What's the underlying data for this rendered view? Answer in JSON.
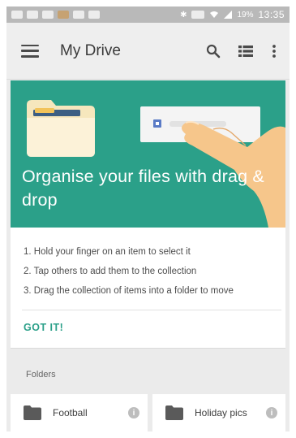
{
  "status_bar": {
    "time": "13:35",
    "battery": "19%"
  },
  "app_bar": {
    "title": "My Drive",
    "icons": [
      "menu-icon",
      "search-icon",
      "list-view-icon",
      "more-vert-icon"
    ]
  },
  "promo": {
    "text": "Organise your files with drag & drop",
    "background": "#2ba089"
  },
  "instructions": {
    "steps": [
      "1. Hold your finger on an item to select it",
      "2. Tap others to add them to the collection",
      "3. Drag the collection of items into a folder to move"
    ],
    "action_label": "GOT IT!"
  },
  "folders": {
    "header": "Folders",
    "items": [
      {
        "name": "Football"
      },
      {
        "name": "Holiday pics"
      }
    ]
  },
  "colors": {
    "accent": "#2ba089",
    "status_bar": "#b9b9b9",
    "app_bar": "#eeeeee"
  }
}
